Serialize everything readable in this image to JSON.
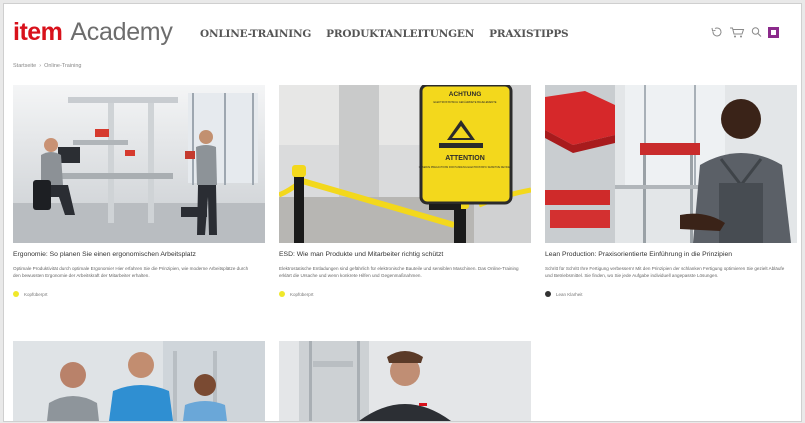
{
  "header": {
    "logo_item": "item",
    "logo_academy": "Academy",
    "nav": [
      "ONLINE-TRAINING",
      "PRODUKTANLEITUNGEN",
      "PRAXISTIPPS"
    ]
  },
  "icons": [
    "history-icon",
    "cart-icon",
    "search-icon",
    "account-icon"
  ],
  "breadcrumb": {
    "home": "Startseite",
    "current": "Online-Training"
  },
  "cards": [
    {
      "title": "Ergonomie: So planen Sie einen ergonomischen Arbeitsplatz",
      "desc": "Optimale Produktivität durch optimale Ergonomie! Hier erfahren Sie die Prinzipien, wie moderne Arbeitsplätze durch den bewussten Ergonomie der Arbeitskraft der Mitarbeiter erhalten.",
      "tag": "Kopfüberprt",
      "tag_color": "#f0e82a"
    },
    {
      "title": "ESD: Wie man Produkte und Mitarbeiter richtig schützt",
      "desc": "Elektrostatische Entladungen sind gefährlich für elektronische Bauteile und sensiblen Maschinen. Das Online-Training erklärt die Ursache und wenn konkrete Hilfen und Gegenmaßnahmen.",
      "tag": "Kopfüberprt",
      "tag_color": "#f0e82a"
    },
    {
      "title": "Lean Production: Praxisorientierte Einführung in die Prinzipien",
      "desc": "Schritt für Schritt Ihre Fertigung verbessern! Mit den Prinzipien der schlanken Fertigung optimieren Sie gezielt Abläufe und Betriebsmittel. Sie finden, wo Sie jede Aufgabe individuell angepasste Lösungen.",
      "tag": "Lean Klarheit",
      "tag_color": "#333333"
    }
  ],
  "alert": {
    "achtung": "ACHTUNG",
    "achtung_sub": "ELEKTROSTATISCH GEFÄHRDETE BAUELEMENTE",
    "attention": "ATTENTION",
    "attention_sub": "OBSERVE PRECAUTIONS FOR HANDLING ELECTROSTATIC SENSITIVE DEVICES"
  },
  "colors": {
    "brand_red": "#d8111b",
    "accent_purple": "#8b2a8b",
    "esd_yellow": "#f3d81c"
  }
}
